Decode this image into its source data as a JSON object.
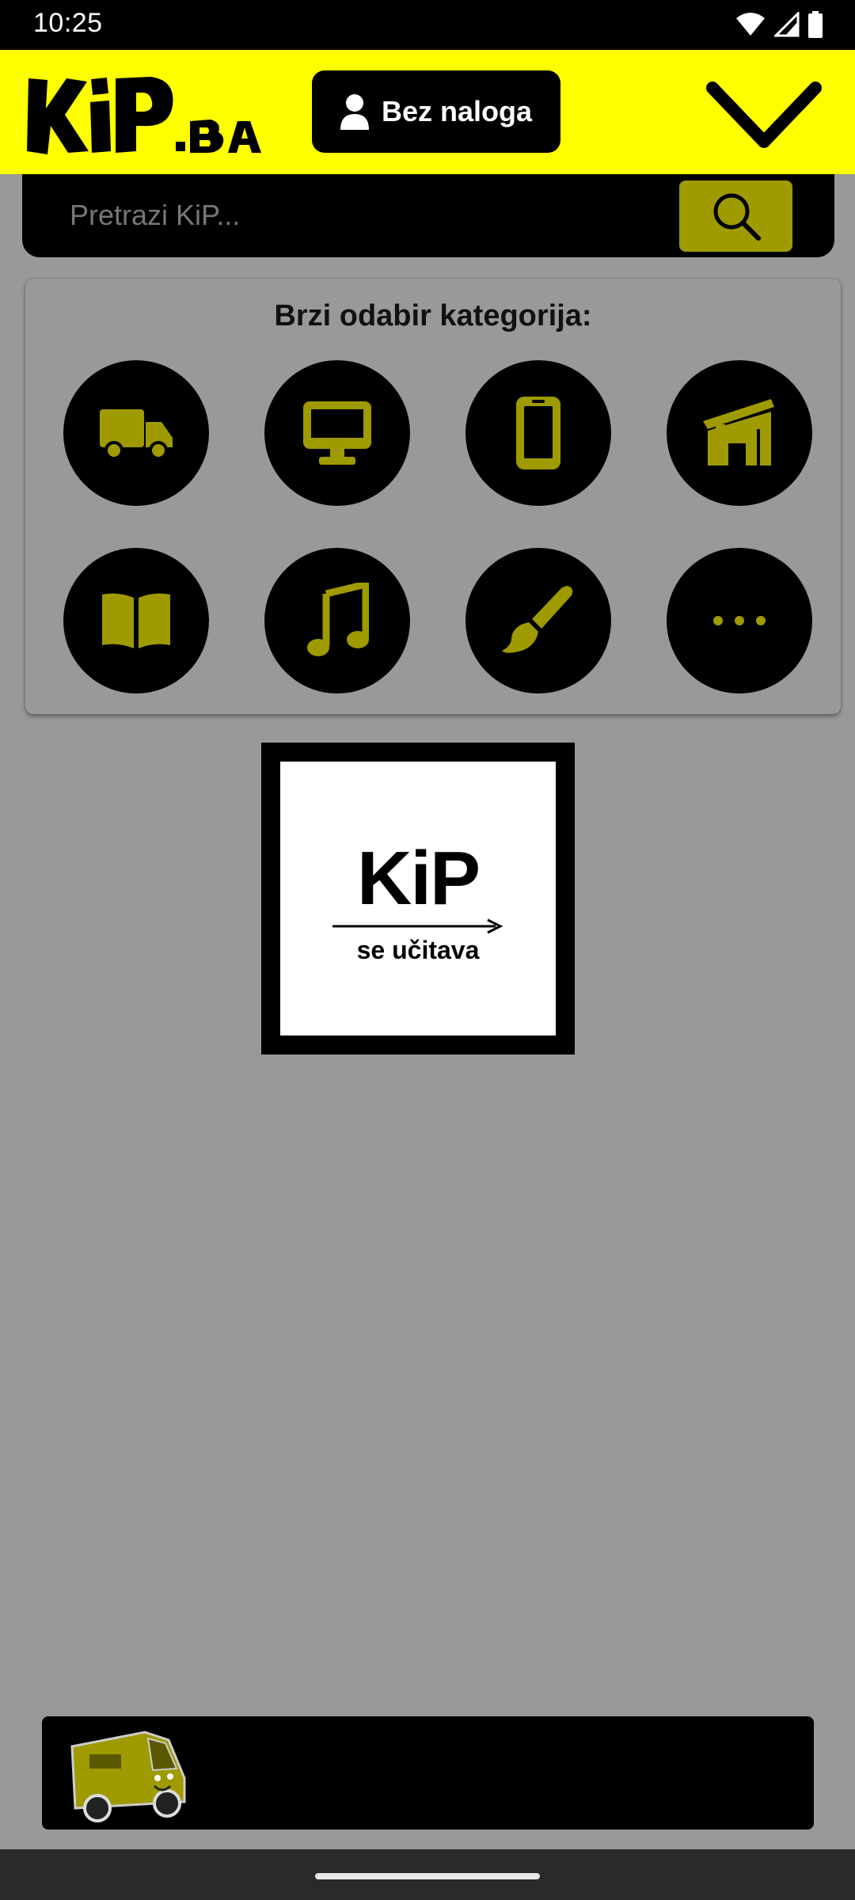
{
  "status_bar": {
    "time": "10:25"
  },
  "header": {
    "logo_text": "KiP.BA",
    "account_label": "Bez naloga",
    "menu_icon": "chevron-down-icon"
  },
  "search": {
    "placeholder": "Pretrazi KiP...",
    "icon": "search-icon"
  },
  "categories": {
    "title": "Brzi odabir kategorija:",
    "items": [
      {
        "icon": "truck-icon"
      },
      {
        "icon": "monitor-icon"
      },
      {
        "icon": "smartphone-icon"
      },
      {
        "icon": "house-icon"
      },
      {
        "icon": "book-icon"
      },
      {
        "icon": "music-note-icon"
      },
      {
        "icon": "paintbrush-icon"
      },
      {
        "icon": "more-dots-icon"
      }
    ]
  },
  "loader": {
    "brand": "KiP",
    "text": "se učitava"
  },
  "footer": {
    "van_icon": "delivery-van-icon"
  },
  "colors": {
    "brand_yellow": "#ffff00",
    "olive": "#9e9a00",
    "dark": "#000000",
    "overlay": "#999999"
  }
}
